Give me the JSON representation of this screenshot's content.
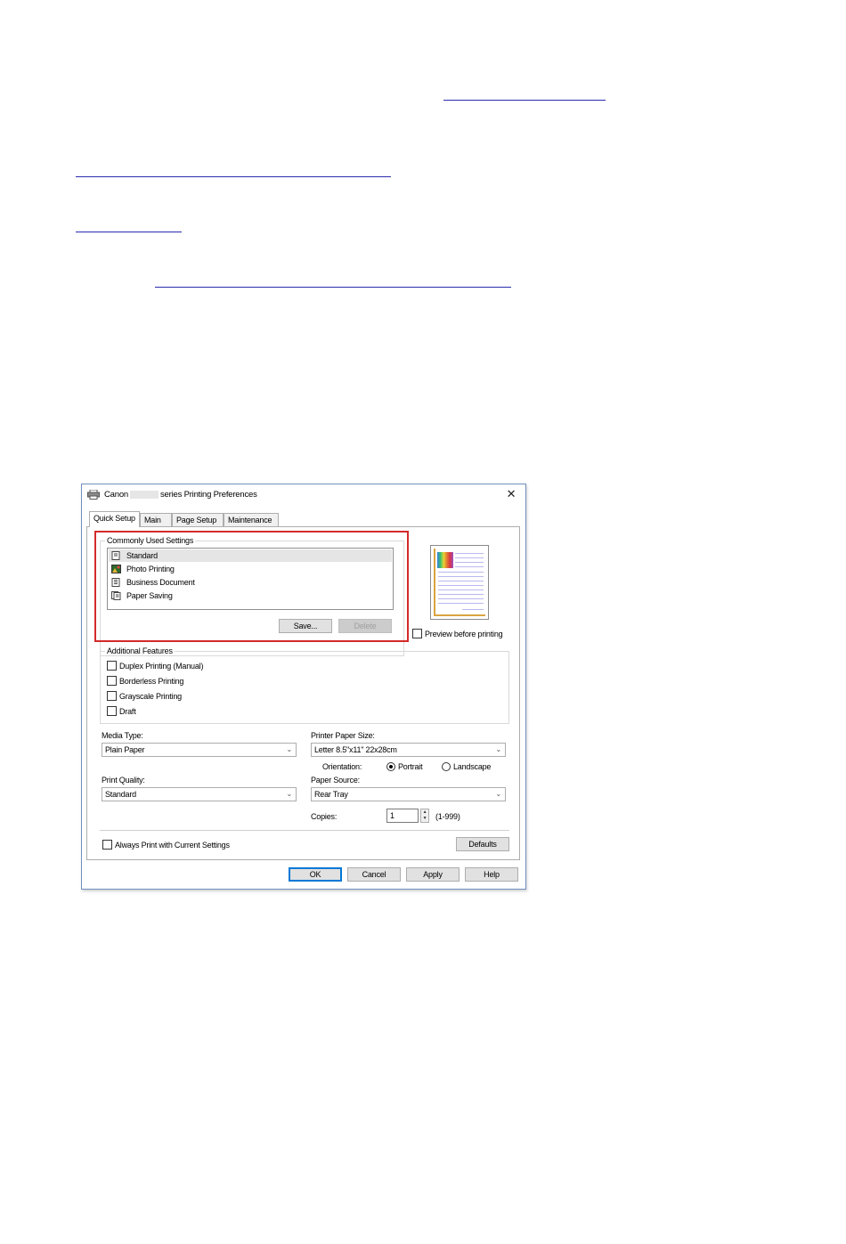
{
  "dialog": {
    "title_prefix": "Canon",
    "title_suffix": "series Printing Preferences",
    "close_label": "✕",
    "tabs": [
      {
        "label": "Quick Setup"
      },
      {
        "label": "Main"
      },
      {
        "label": "Page Setup"
      },
      {
        "label": "Maintenance"
      }
    ],
    "commonly_used": {
      "label": "Commonly Used Settings",
      "items": [
        {
          "label": "Standard",
          "icon": "standard-doc-icon",
          "selected": true
        },
        {
          "label": "Photo Printing",
          "icon": "photo-icon",
          "selected": false
        },
        {
          "label": "Business Document",
          "icon": "business-doc-icon",
          "selected": false
        },
        {
          "label": "Paper Saving",
          "icon": "paper-saving-icon",
          "selected": false
        }
      ],
      "save_label": "Save...",
      "delete_label": "Delete"
    },
    "preview": {
      "checkbox_label": "Preview before printing",
      "checked": false
    },
    "additional": {
      "label": "Additional Features",
      "options": [
        {
          "label": "Duplex Printing (Manual)",
          "checked": false
        },
        {
          "label": "Borderless Printing",
          "checked": false
        },
        {
          "label": "Grayscale Printing",
          "checked": false
        },
        {
          "label": "Draft",
          "checked": false
        }
      ]
    },
    "media_type": {
      "label": "Media Type:",
      "value": "Plain Paper"
    },
    "paper_size": {
      "label": "Printer Paper Size:",
      "value": "Letter 8.5\"x11\" 22x28cm"
    },
    "orientation": {
      "label": "Orientation:",
      "portrait": "Portrait",
      "landscape": "Landscape",
      "selected": "Portrait"
    },
    "print_quality": {
      "label": "Print Quality:",
      "value": "Standard"
    },
    "paper_source": {
      "label": "Paper Source:",
      "value": "Rear Tray"
    },
    "copies": {
      "label": "Copies:",
      "value": "1",
      "range": "(1-999)"
    },
    "always_print": {
      "label": "Always Print with Current Settings",
      "checked": false
    },
    "defaults_label": "Defaults",
    "buttons": {
      "ok": "OK",
      "cancel": "Cancel",
      "apply": "Apply",
      "help": "Help"
    },
    "colors": {
      "highlight_frame": "#d42a2a",
      "default_button": "#0078d7",
      "link": "#2b2bb0"
    }
  }
}
